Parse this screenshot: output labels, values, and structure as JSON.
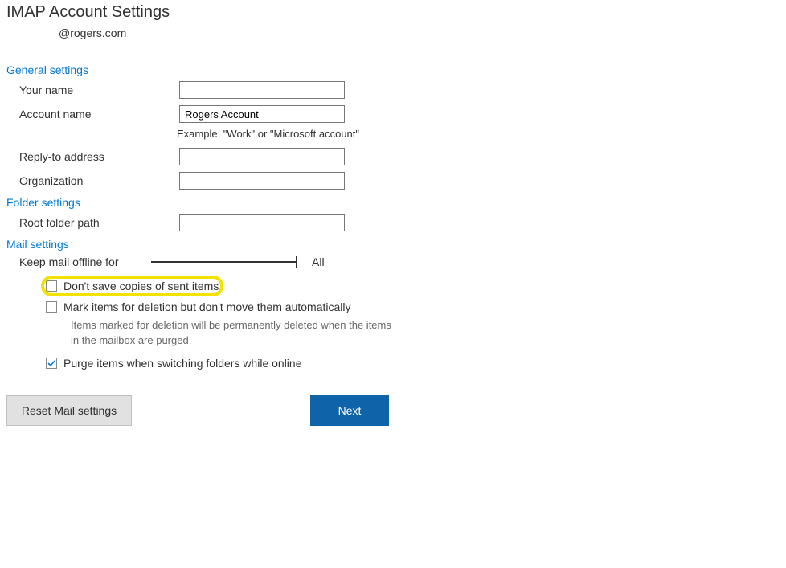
{
  "page_title": "IMAP Account Settings",
  "email": "@rogers.com",
  "sections": {
    "general": {
      "title": "General settings",
      "your_name_label": "Your name",
      "your_name_value": "",
      "account_name_label": "Account name",
      "account_name_value": "Rogers Account",
      "account_name_example": "Example: \"Work\" or \"Microsoft account\"",
      "reply_to_label": "Reply-to address",
      "reply_to_value": "",
      "organization_label": "Organization",
      "organization_value": ""
    },
    "folder": {
      "title": "Folder settings",
      "root_folder_label": "Root folder path",
      "root_folder_value": ""
    },
    "mail": {
      "title": "Mail settings",
      "keep_offline_label": "Keep mail offline for",
      "keep_offline_value": "All",
      "dont_save_sent_label": "Don't save copies of sent items",
      "dont_save_sent_checked": false,
      "mark_delete_label": "Mark items for deletion but don't move them automatically",
      "mark_delete_checked": false,
      "mark_delete_help": "Items marked for deletion will be permanently deleted when the items in the mailbox are purged.",
      "purge_label": "Purge items when switching folders while online",
      "purge_checked": true
    }
  },
  "buttons": {
    "reset": "Reset Mail settings",
    "next": "Next"
  }
}
